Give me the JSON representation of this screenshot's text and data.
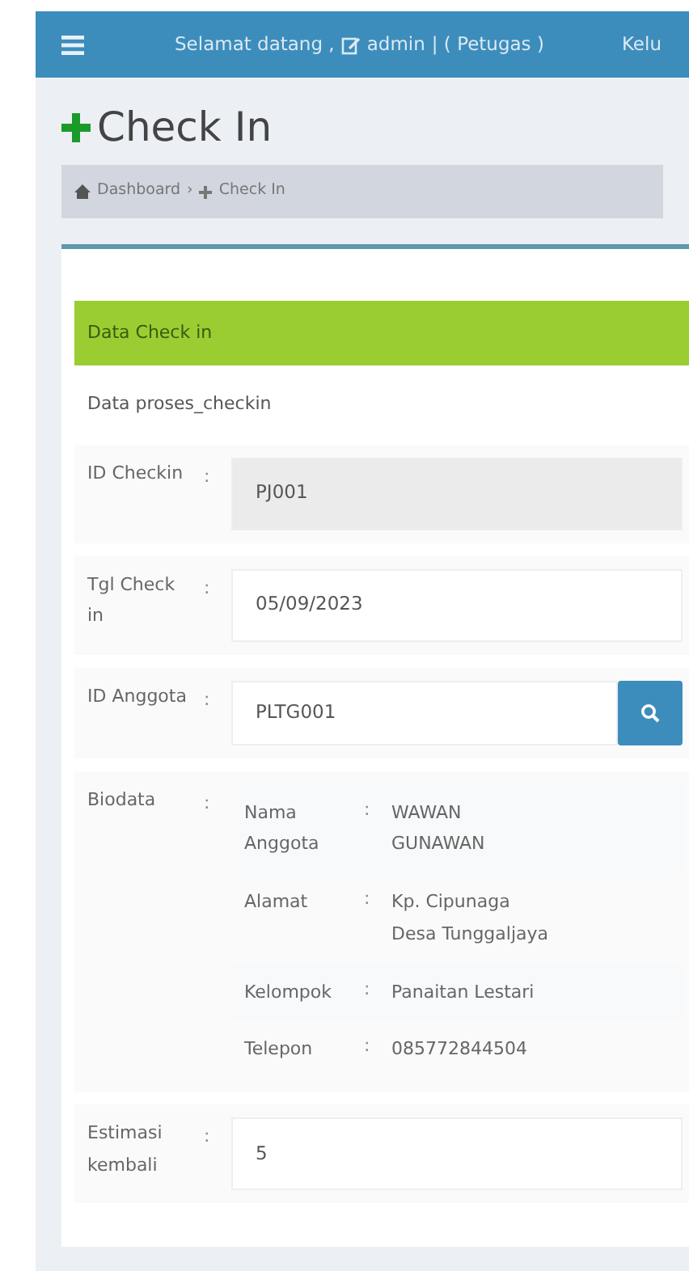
{
  "header": {
    "greeting": "Selamat datang ,",
    "user": "admin",
    "role": "| ( Petugas )",
    "logout": "Kelu"
  },
  "page_title": "Check In",
  "breadcrumb": [
    {
      "label": "Dashboard"
    },
    {
      "separator": "›",
      "label": "Check In"
    }
  ],
  "box": {
    "title": "Data Check in",
    "subtitle": "Data proses_checkin",
    "rows": [
      {
        "kind": "field",
        "label": "ID Checkin",
        "colon": ":",
        "value": "PJ001",
        "readonly": true
      },
      {
        "kind": "field",
        "label": "Tgl Check in",
        "colon": ":",
        "value": "05/09/2023",
        "readonly": false
      },
      {
        "kind": "search",
        "label": "ID Anggota",
        "colon": ":",
        "value": "PLTG001",
        "readonly": false
      },
      {
        "kind": "details",
        "label": "Biodata",
        "colon": ":",
        "items": [
          {
            "label": "Nama Anggota",
            "colon": ":",
            "value": "WAWAN GUNAWAN"
          },
          {
            "label": "Alamat",
            "colon": ":",
            "value": "Kp. Cipunaga Desa Tunggaljaya"
          },
          {
            "label": "Kelompok",
            "colon": ":",
            "value": "Panaitan Lestari"
          },
          {
            "label": "Telepon",
            "colon": ":",
            "value": "085772844504"
          }
        ]
      },
      {
        "kind": "field",
        "label": "Estimasi kembali",
        "colon": ":",
        "value": "5",
        "readonly": false
      }
    ]
  }
}
